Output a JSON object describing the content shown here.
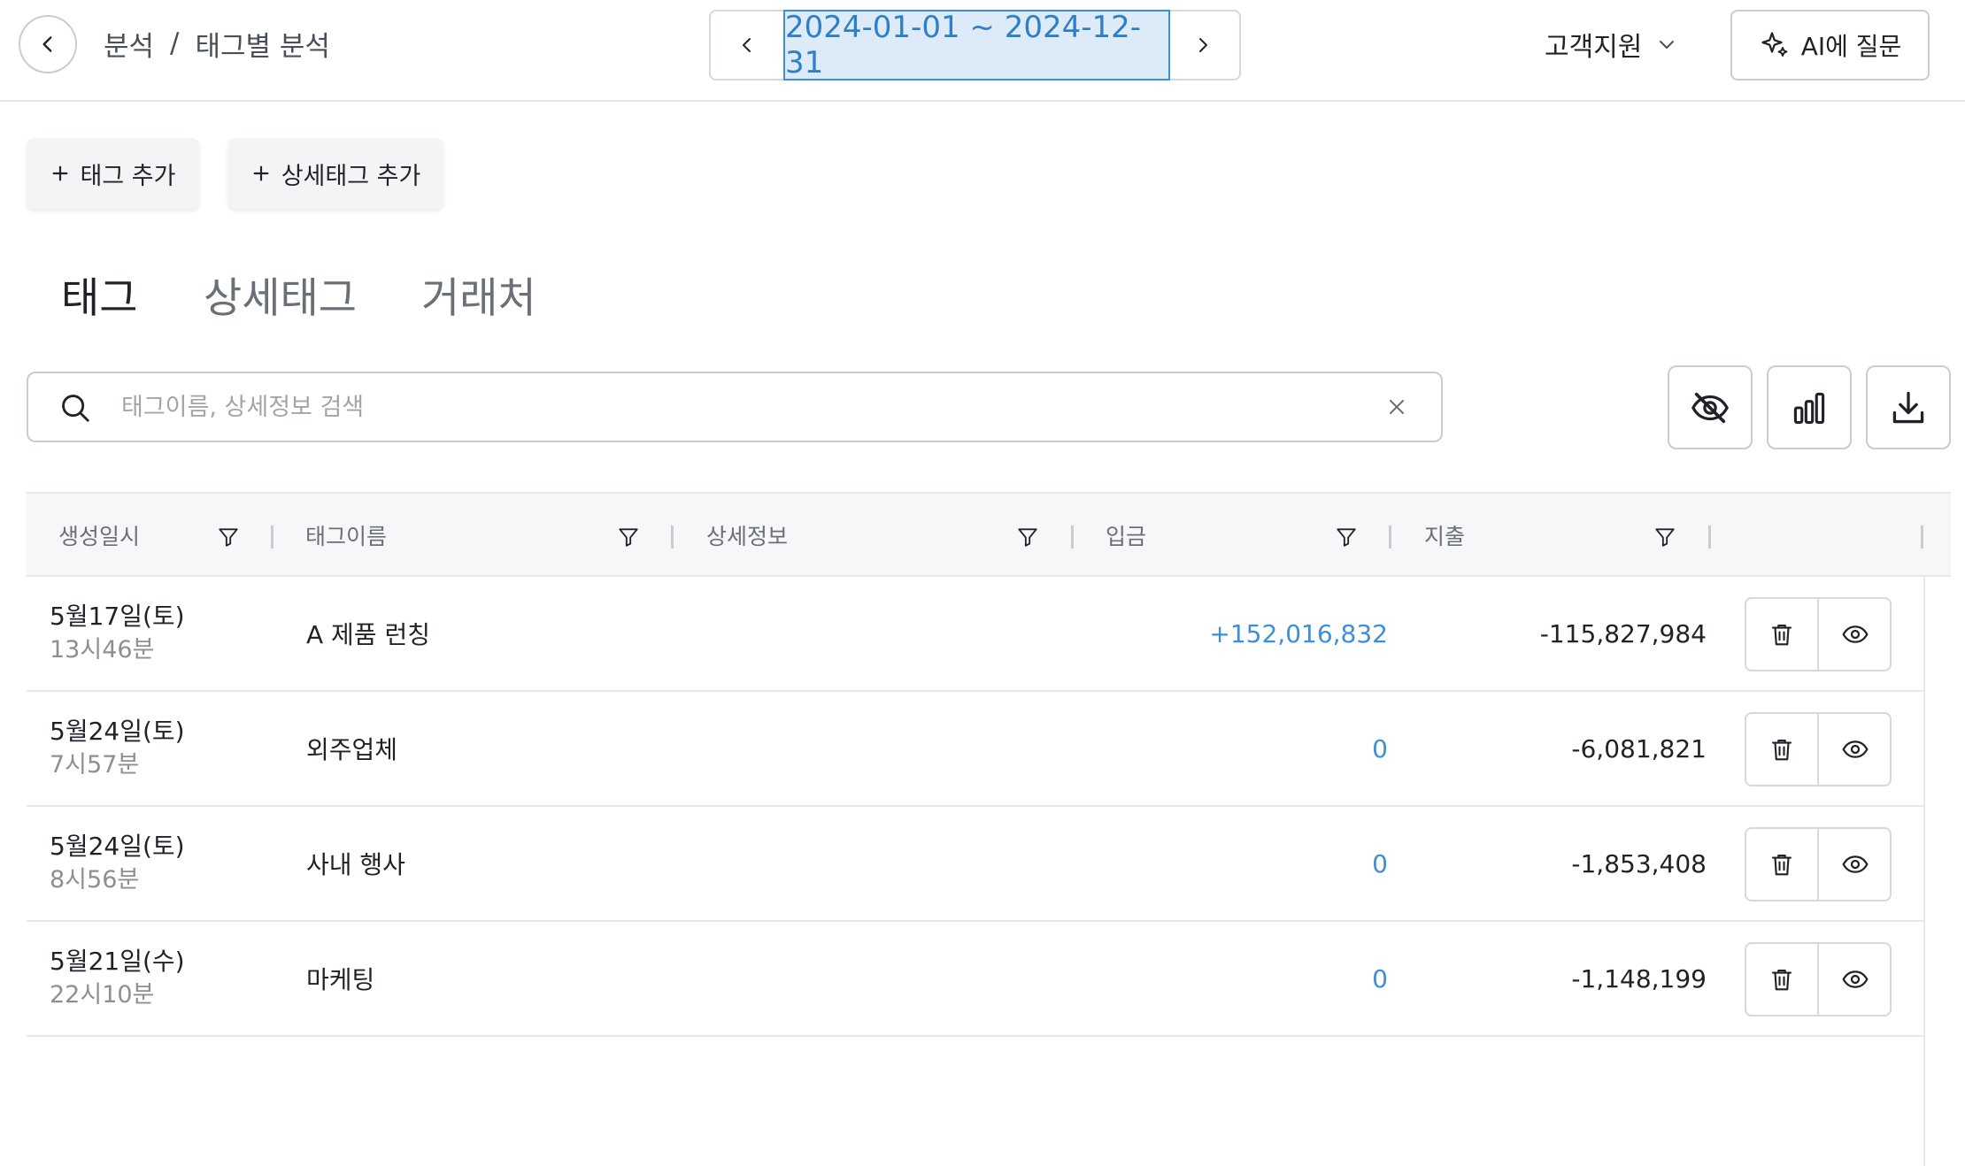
{
  "header": {
    "breadcrumb": [
      "분석",
      "태그별 분석"
    ],
    "breadcrumb_sep": "/",
    "date_range": "2024-01-01 ~ 2024-12-31",
    "support_label": "고객지원",
    "ai_button_label": "AI에 질문"
  },
  "actions": {
    "add_tag_label": "태그 추가",
    "add_detail_tag_label": "상세태그 추가"
  },
  "tabs": [
    {
      "label": "태그",
      "active": true
    },
    {
      "label": "상세태그",
      "active": false
    },
    {
      "label": "거래처",
      "active": false
    }
  ],
  "search": {
    "placeholder": "태그이름, 상세정보 검색",
    "value": ""
  },
  "toolbar_icons": [
    "eye-off-icon",
    "bar-chart-icon",
    "download-icon"
  ],
  "table": {
    "columns": [
      "생성일시",
      "태그이름",
      "상세정보",
      "입금",
      "지출"
    ],
    "rows": [
      {
        "date": "5월17일(토)",
        "time": "13시46분",
        "name": "A 제품 런칭",
        "detail": "",
        "income": "+152,016,832",
        "expense": "-115,827,984"
      },
      {
        "date": "5월24일(토)",
        "time": "7시57분",
        "name": "외주업체",
        "detail": "",
        "income": "0",
        "expense": "-6,081,821"
      },
      {
        "date": "5월24일(토)",
        "time": "8시56분",
        "name": "사내 행사",
        "detail": "",
        "income": "0",
        "expense": "-1,853,408"
      },
      {
        "date": "5월21일(수)",
        "time": "22시10분",
        "name": "마케팅",
        "detail": "",
        "income": "0",
        "expense": "-1,148,199"
      }
    ]
  },
  "colors": {
    "accent": "#3f8fd6",
    "date_range_bg": "#ddebf8",
    "text": "#1f2329",
    "muted": "#8b9097"
  }
}
